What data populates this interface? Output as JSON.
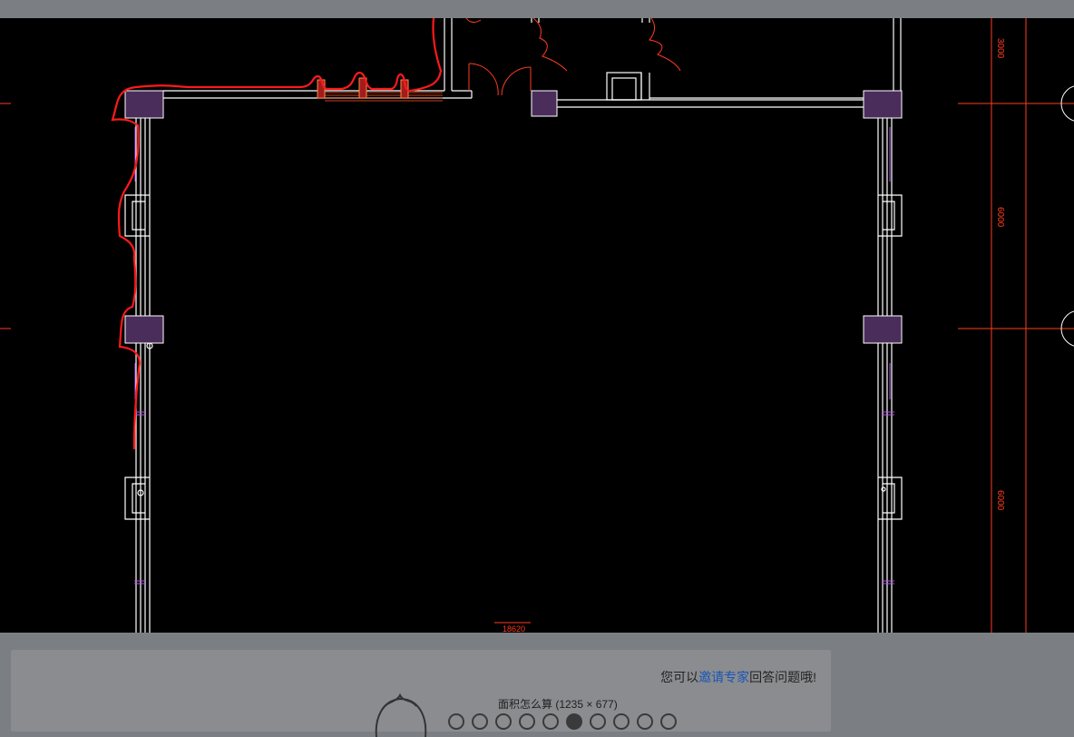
{
  "viewer": {
    "dimension_top": "3000",
    "dimension_middle": "6000",
    "dimension_bottom": "6000",
    "dimension_width": "18620"
  },
  "panel": {
    "invite_prefix": "您可以",
    "invite_link": "邀请专家",
    "invite_suffix": "回答问题哦!",
    "caption": "面积怎么算 (1235 × 677)",
    "thumbnail_count": 10,
    "active_thumbnail": 5
  },
  "colors": {
    "background": "#000000",
    "wall": "#ffffff",
    "column_fill": "#4b2d5c",
    "dimension": "#ff3b1f",
    "markup": "#ff1a1a",
    "window": "#b552e0"
  },
  "icons": [
    "avatar-icon"
  ]
}
